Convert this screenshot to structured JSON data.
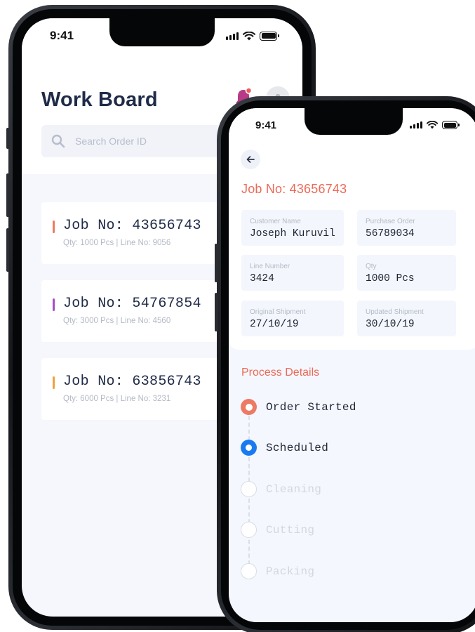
{
  "status_bar": {
    "time": "9:41"
  },
  "work_board": {
    "title": "Work Board",
    "search_placeholder": "Search Order ID",
    "jobs": [
      {
        "title": "Job No: 43656743",
        "subtitle": "Qty: 1000 Pcs | Line No: 9056",
        "accent": "#ec7a5f"
      },
      {
        "title": "Job No: 54767854",
        "subtitle": "Qty: 3000 Pcs | Line No: 4560",
        "accent": "#a64fc4"
      },
      {
        "title": "Job No: 63856743",
        "subtitle": "Qty: 6000 Pcs | Line No: 3231",
        "accent": "#f0a13b"
      }
    ],
    "colors": {
      "title": "#1f2b48",
      "bell": "#b73a86",
      "bell_badge": "#ec5b57"
    },
    "icons": [
      "search-icon",
      "bell-icon",
      "user-icon"
    ]
  },
  "job_detail": {
    "title": "Job No: 43656743",
    "fields": {
      "customer_name": {
        "label": "Customer Name",
        "value": "Joseph Kuruvila"
      },
      "purchase_order": {
        "label": "Purchase Order",
        "value": "56789034"
      },
      "line_number": {
        "label": "Line Number",
        "value": "3424"
      },
      "qty": {
        "label": "Qty",
        "value": "1000 Pcs"
      },
      "original_shipment": {
        "label": "Original Shipment",
        "value": "27/10/19"
      },
      "updated_shipment": {
        "label": "Updated Shipment",
        "value": "30/10/19"
      }
    },
    "process_title": "Process Details",
    "steps": [
      {
        "label": "Order Started",
        "state": "done"
      },
      {
        "label": "Scheduled",
        "state": "active"
      },
      {
        "label": "Cleaning",
        "state": "pending"
      },
      {
        "label": "Cutting",
        "state": "pending"
      },
      {
        "label": "Packing",
        "state": "pending"
      }
    ],
    "colors": {
      "accent": "#ec6a58",
      "active": "#1a7bf0"
    },
    "icons": [
      "back-arrow-icon"
    ]
  }
}
